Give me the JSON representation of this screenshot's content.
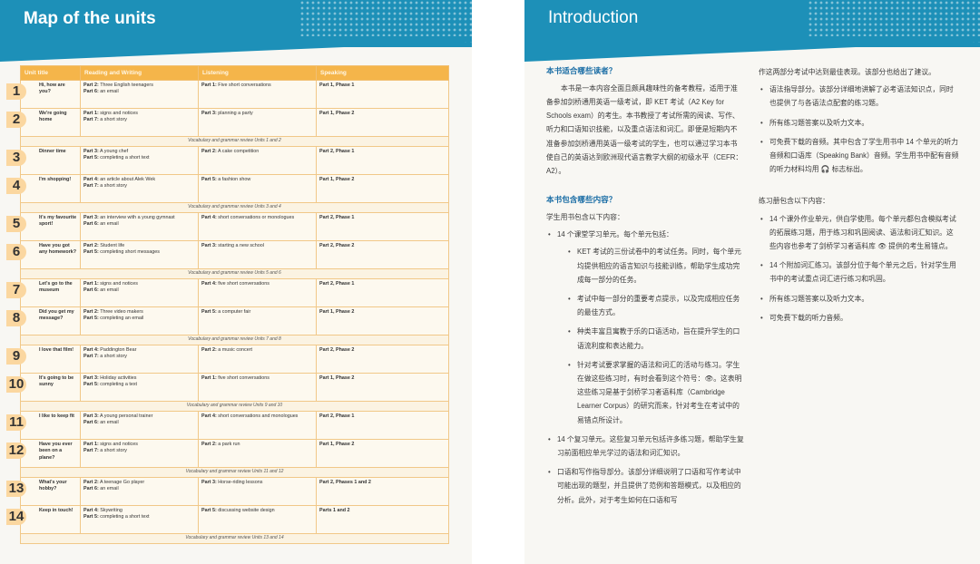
{
  "left_page": {
    "title": "Map of the units",
    "columns": [
      "Unit title",
      "Reading and Writing",
      "Listening",
      "Speaking"
    ],
    "units": [
      {
        "num": "1",
        "title": "Hi, how are you?",
        "reading": [
          {
            "part": "Part 2:",
            "text": "Three English teenagers"
          },
          {
            "part": "Part 6:",
            "text": "an email"
          }
        ],
        "listening": [
          {
            "part": "Part 1:",
            "text": "Five short conversations"
          }
        ],
        "speaking": "Part 1, Phase 1"
      },
      {
        "num": "2",
        "title": "We're going home",
        "reading": [
          {
            "part": "Part 1:",
            "text": "signs and notices"
          },
          {
            "part": "Part 7:",
            "text": "a short story"
          }
        ],
        "listening": [
          {
            "part": "Part 3:",
            "text": "planning a party"
          }
        ],
        "speaking": "Part 1, Phase 2"
      },
      {
        "review": "Vocabulary and grammar review Units 1 and 2"
      },
      {
        "num": "3",
        "title": "Dinner time",
        "reading": [
          {
            "part": "Part 3:",
            "text": "A young chef"
          },
          {
            "part": "Part 5:",
            "text": "completing a short text"
          }
        ],
        "listening": [
          {
            "part": "Part 2:",
            "text": "A cake competition"
          }
        ],
        "speaking": "Part 2, Phase 1"
      },
      {
        "num": "4",
        "title": "I'm shopping!",
        "reading": [
          {
            "part": "Part 4:",
            "text": "an article about Alek Wek"
          },
          {
            "part": "Part 7:",
            "text": "a short story"
          }
        ],
        "listening": [
          {
            "part": "Part 5:",
            "text": "a fashion show"
          }
        ],
        "speaking": "Part 1, Phase 2"
      },
      {
        "review": "Vocabulary and grammar review Units 3 and 4"
      },
      {
        "num": "5",
        "title": "It's my favourite sport!",
        "reading": [
          {
            "part": "Part 3:",
            "text": "an interview with a young gymnast"
          },
          {
            "part": "Part 6:",
            "text": "an email"
          }
        ],
        "listening": [
          {
            "part": "Part 4:",
            "text": "short conversations or monologues"
          }
        ],
        "speaking": "Part 2, Phase 1"
      },
      {
        "num": "6",
        "title": "Have you got any homework?",
        "reading": [
          {
            "part": "Part 2:",
            "text": "Student life"
          },
          {
            "part": "Part 5:",
            "text": "completing short messages"
          }
        ],
        "listening": [
          {
            "part": "Part 3:",
            "text": "starting a new school"
          }
        ],
        "speaking": "Part 2, Phase 2"
      },
      {
        "review": "Vocabulary and grammar review Units 5 and 6"
      },
      {
        "num": "7",
        "title": "Let's go to the museum",
        "reading": [
          {
            "part": "Part 1:",
            "text": "signs and notices"
          },
          {
            "part": "Part 6:",
            "text": "an email"
          }
        ],
        "listening": [
          {
            "part": "Part 4:",
            "text": "five short conversations"
          }
        ],
        "speaking": "Part 2, Phase 1"
      },
      {
        "num": "8",
        "title": "Did you get my message?",
        "reading": [
          {
            "part": "Part 2:",
            "text": "Three video makers"
          },
          {
            "part": "Part 5:",
            "text": "completing an email"
          }
        ],
        "listening": [
          {
            "part": "Part 5:",
            "text": "a computer fair"
          }
        ],
        "speaking": "Part 1, Phase 2"
      },
      {
        "review": "Vocabulary and grammar review Units 7 and 8"
      },
      {
        "num": "9",
        "title": "I love that film!",
        "reading": [
          {
            "part": "Part 4:",
            "text": "Paddington Bear"
          },
          {
            "part": "Part 7:",
            "text": "a short story"
          }
        ],
        "listening": [
          {
            "part": "Part 2:",
            "text": "a music concert"
          }
        ],
        "speaking": "Part 2, Phase 2"
      },
      {
        "num": "10",
        "title": "It's going to be sunny",
        "reading": [
          {
            "part": "Part 3:",
            "text": "Holiday activities"
          },
          {
            "part": "Part 5:",
            "text": "completing a text"
          }
        ],
        "listening": [
          {
            "part": "Part 1:",
            "text": "five short conversations"
          }
        ],
        "speaking": "Part 1, Phase 2"
      },
      {
        "review": "Vocabulary and grammar review Units 9 and 10"
      },
      {
        "num": "11",
        "title": "I like to keep fit",
        "reading": [
          {
            "part": "Part 3:",
            "text": "A young personal trainer"
          },
          {
            "part": "Part 6:",
            "text": "an email"
          }
        ],
        "listening": [
          {
            "part": "Part 4:",
            "text": "short conversations and monologues"
          }
        ],
        "speaking": "Part 2, Phase 1"
      },
      {
        "num": "12",
        "title": "Have you ever been on a plane?",
        "reading": [
          {
            "part": "Part 1:",
            "text": "signs and notices"
          },
          {
            "part": "Part 7:",
            "text": "a short story"
          }
        ],
        "listening": [
          {
            "part": "Part 2:",
            "text": "a park run"
          }
        ],
        "speaking": "Part 1, Phase 2"
      },
      {
        "review": "Vocabulary and grammar review Units 11 and 12"
      },
      {
        "num": "13",
        "title": "What's your hobby?",
        "reading": [
          {
            "part": "Part 2:",
            "text": "A teenage Go player"
          },
          {
            "part": "Part 6:",
            "text": "an email"
          }
        ],
        "listening": [
          {
            "part": "Part 3:",
            "text": "Horse-riding lessons"
          }
        ],
        "speaking": "Part 2, Phases 1 and 2"
      },
      {
        "num": "14",
        "title": "Keep in touch!",
        "reading": [
          {
            "part": "Part 4:",
            "text": "Skywriting"
          },
          {
            "part": "Part 5:",
            "text": "completing a short text"
          }
        ],
        "listening": [
          {
            "part": "Part 5:",
            "text": "discussing website design"
          }
        ],
        "speaking": "Parts 1 and 2"
      },
      {
        "review": "Vocabulary and grammar review Units 13 and 14"
      }
    ]
  },
  "right_page": {
    "title": "Introduction",
    "who_heading": "本书适合哪些读者？",
    "who_para": "本书是一本内容全面且颇具趣味性的备考教程，适用于准备参加剑桥通用英语一级考试，即 KET 考试（A2 Key for Schools exam）的考生。本书教授了考试所需的阅读、写作、听力和口语知识技能，以及重点语法和词汇。即便是短期内不准备参加剑桥通用英语一级考试的学生，也可以通过学习本书使自己的英语达到欧洲现代语言教学大纲的初级水平（CEFR：A2）。",
    "contents_heading": "本书包含哪些内容？",
    "student_book_intro": "学生用书包含以下内容：",
    "left_bullets": [
      "14 个课堂学习单元。每个单元包括：",
      "14 个复习单元。这些复习单元包括许多练习题，帮助学生复习前面相应单元学过的语法和词汇知识。",
      "口语和写作指导部分。该部分详细说明了口语和写作考试中可能出现的题型，并且提供了范例和答题模式，以及相应的分析。此外，对于考生如何在口语和写"
    ],
    "sub_bullets": [
      "KET 考试的三份试卷中的考试任务。同时，每个单元均提供相应的语言知识与技能训练，帮助学生成功完成每一部分的任务。",
      "考试中每一部分的重要考点提示，以及完成相应任务的最佳方式。",
      "种类丰富且寓教于乐的口语活动，旨在提升学生的口语流利度和表达能力。",
      "针对考试要求掌握的语法和词汇的活动与练习。学生在做这些练习时，有时会看到这个符号：👁。这表明这些练习是基于剑桥学习者语料库（Cambridge Learner Corpus）的研究而来，针对考生在考试中的易错点所设计。"
    ],
    "right_col_intro": "作这两部分考试中达到最佳表现。该部分也给出了建议。",
    "right_bullets": [
      "语法指导部分。该部分详细地讲解了必考语法知识点，同时也提供了与各语法点配套的练习题。",
      "所有练习题答案以及听力文本。",
      "可免费下载的音频。其中包含了学生用书中 14 个单元的听力音频和口语库（Speaking Bank）音频。学生用书中配有音频的听力材料均用 🎧 标志标出。"
    ],
    "workbook_intro": "练习册包含以下内容：",
    "workbook_bullets": [
      "14 个课外作业单元，供自学使用。每个单元都包含模拟考试的拓展练习题，用于练习和巩固阅读、语法和词汇知识。这些内容也参考了剑桥学习者语料库 👁 提供的考生易错点。",
      "14 个附加词汇练习。该部分位于每个单元之后，针对学生用书中的考试重点词汇进行练习和巩固。",
      "所有练习题答案以及听力文本。",
      "可免费下载的听力音频。"
    ]
  }
}
